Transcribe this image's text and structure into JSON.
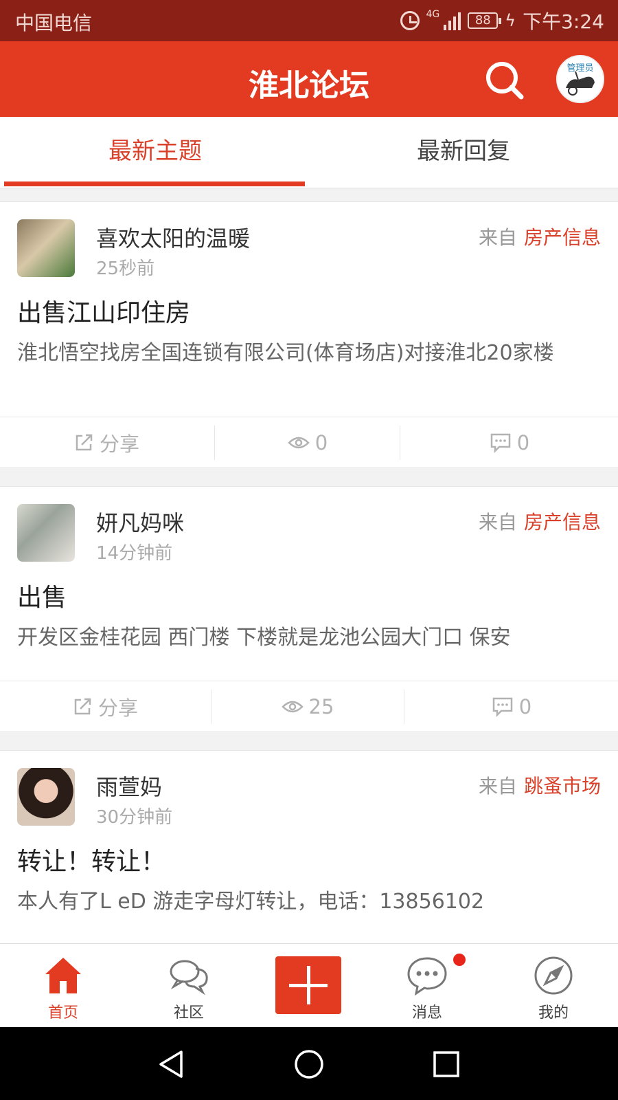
{
  "status_bar": {
    "carrier": "中国电信",
    "network": "4G",
    "battery": "88",
    "time": "下午3:24"
  },
  "header": {
    "title": "淮北论坛",
    "admin_badge": "管理员"
  },
  "tabs": [
    {
      "label": "最新主题",
      "active": true
    },
    {
      "label": "最新回复",
      "active": false
    }
  ],
  "posts": [
    {
      "author": "喜欢太阳的温暖",
      "time": "25秒前",
      "source_prefix": "来自",
      "category": "房产信息",
      "title": "出售江山印住房",
      "excerpt": "淮北悟空找房全国连锁有限公司(体育场店)对接淮北20家楼",
      "share_label": "分享",
      "views": "0",
      "comments": "0"
    },
    {
      "author": "妍凡妈咪",
      "time": "14分钟前",
      "source_prefix": "来自",
      "category": "房产信息",
      "title": "出售",
      "excerpt": "开发区金桂花园 西门楼  下楼就是龙池公园大门口  保安",
      "share_label": "分享",
      "views": "25",
      "comments": "0"
    },
    {
      "author": "雨萱妈",
      "time": "30分钟前",
      "source_prefix": "来自",
      "category": "跳蚤市场",
      "title": "转让！转让！",
      "excerpt": "本人有了L eD 游走字母灯转让，电话：13856102"
    }
  ],
  "bottom_nav": [
    {
      "label": "首页",
      "icon": "home-icon",
      "active": true
    },
    {
      "label": "社区",
      "icon": "chat-bubbles-icon"
    },
    {
      "label": "",
      "icon": "plus-icon"
    },
    {
      "label": "消息",
      "icon": "message-icon",
      "badge": true
    },
    {
      "label": "我的",
      "icon": "compass-icon"
    }
  ],
  "colors": {
    "accent": "#e33b21",
    "status_bar": "#8b2116",
    "category": "#d9412b"
  }
}
